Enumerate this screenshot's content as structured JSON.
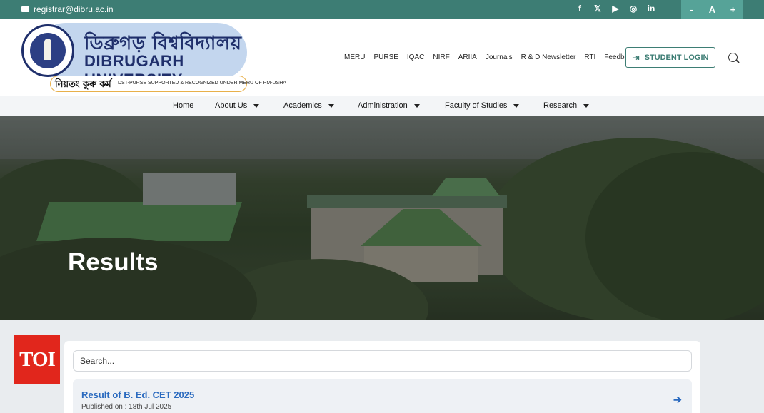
{
  "topbar": {
    "email": "registrar@dibru.ac.in",
    "social_icons": [
      "f",
      "𝕏",
      "▶",
      "◎",
      "in"
    ],
    "social_icon_names": [
      "facebook-icon",
      "x-icon",
      "youtube-icon",
      "instagram-icon",
      "linkedin-icon"
    ],
    "font_controls": [
      "-",
      "A",
      "+"
    ]
  },
  "logo": {
    "assamese_name": "ডিব্ৰুগড় বিশ্ববিদ্যালয়",
    "english_name": "DIBRUGARH UNIVERSITY",
    "motto": "নিয়তং কুৰু কৰ্ম",
    "dst_text": "DST-PURSE SUPPORTED & RECOGNIZED UNDER MERU OF PM-USHA"
  },
  "topnav": [
    "MERU",
    "PURSE",
    "IQAC",
    "NIRF",
    "ARIIA",
    "Journals",
    "R & D Newsletter",
    "RTI",
    "Feedback"
  ],
  "login_button": "STUDENT LOGIN",
  "mainmenu": {
    "home": "Home",
    "about": "About Us",
    "academics": "Academics",
    "administration": "Administration",
    "faculty": "Faculty of Studies",
    "research": "Research"
  },
  "hero": {
    "title": "Results"
  },
  "search": {
    "placeholder": "Search..."
  },
  "results": [
    {
      "title": "Result of B. Ed. CET 2025",
      "published": "Published on : 18th Jul 2025"
    }
  ],
  "watermark": "TOI",
  "colors": {
    "teal": "#3d7d74",
    "link_blue": "#2a6abf",
    "navy": "#1f2f6b"
  }
}
